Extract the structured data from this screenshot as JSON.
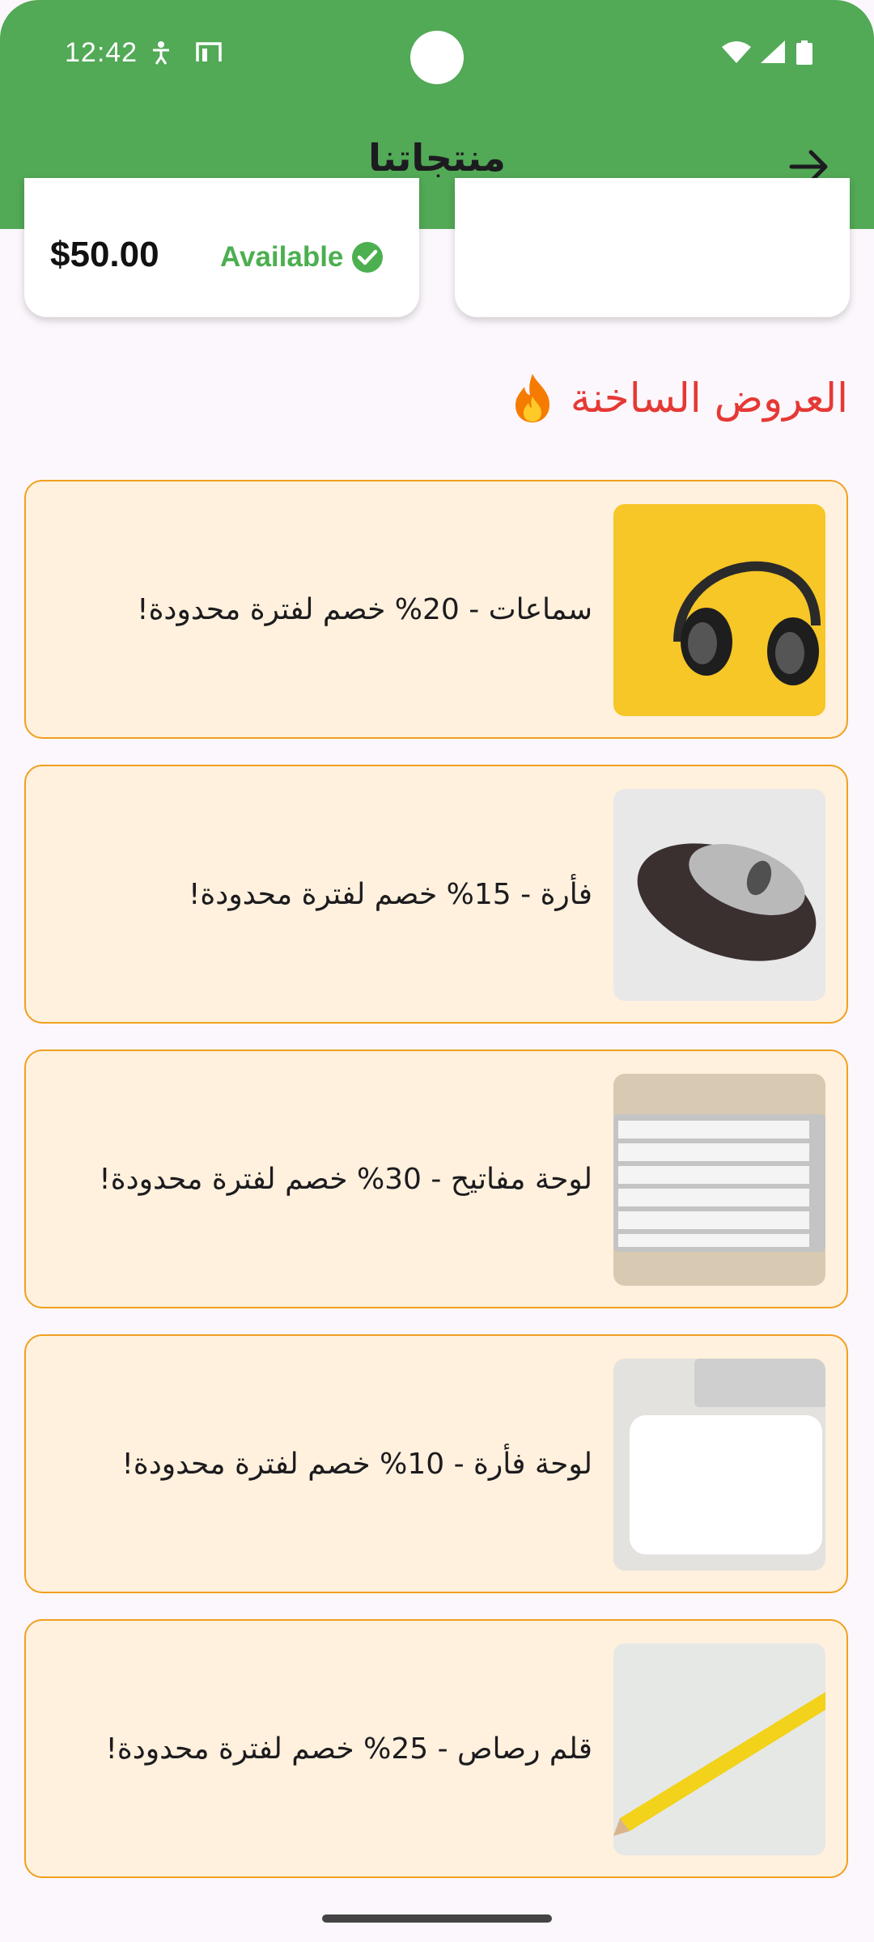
{
  "status_bar": {
    "time": "12:42",
    "icons": [
      "accessibility-icon",
      "screen-icon",
      "wifi-icon",
      "signal-icon",
      "battery-icon"
    ]
  },
  "app_bar": {
    "title": "منتجاتنا",
    "back_icon": "arrow-right-icon",
    "color": "#52a956"
  },
  "product_cards": [
    {
      "price": "$50.00",
      "availability": "Available",
      "availability_color": "#4caf50"
    },
    {
      "price": "",
      "availability": ""
    }
  ],
  "hot_deals": {
    "title": "العروض الساخنة",
    "icon": "fire-icon",
    "title_color": "#e53935",
    "items": [
      {
        "label": "سماعات - 20% خصم لفترة محدودة!",
        "image": "headphones-image"
      },
      {
        "label": "فأرة - 15% خصم لفترة محدودة!",
        "image": "mouse-image"
      },
      {
        "label": "لوحة مفاتيح - 30% خصم لفترة محدودة!",
        "image": "keyboard-image"
      },
      {
        "label": "لوحة فأرة - 10% خصم لفترة محدودة!",
        "image": "mousepad-image"
      },
      {
        "label": "قلم رصاص - 25% خصم لفترة محدودة!",
        "image": "pencil-image"
      }
    ]
  }
}
